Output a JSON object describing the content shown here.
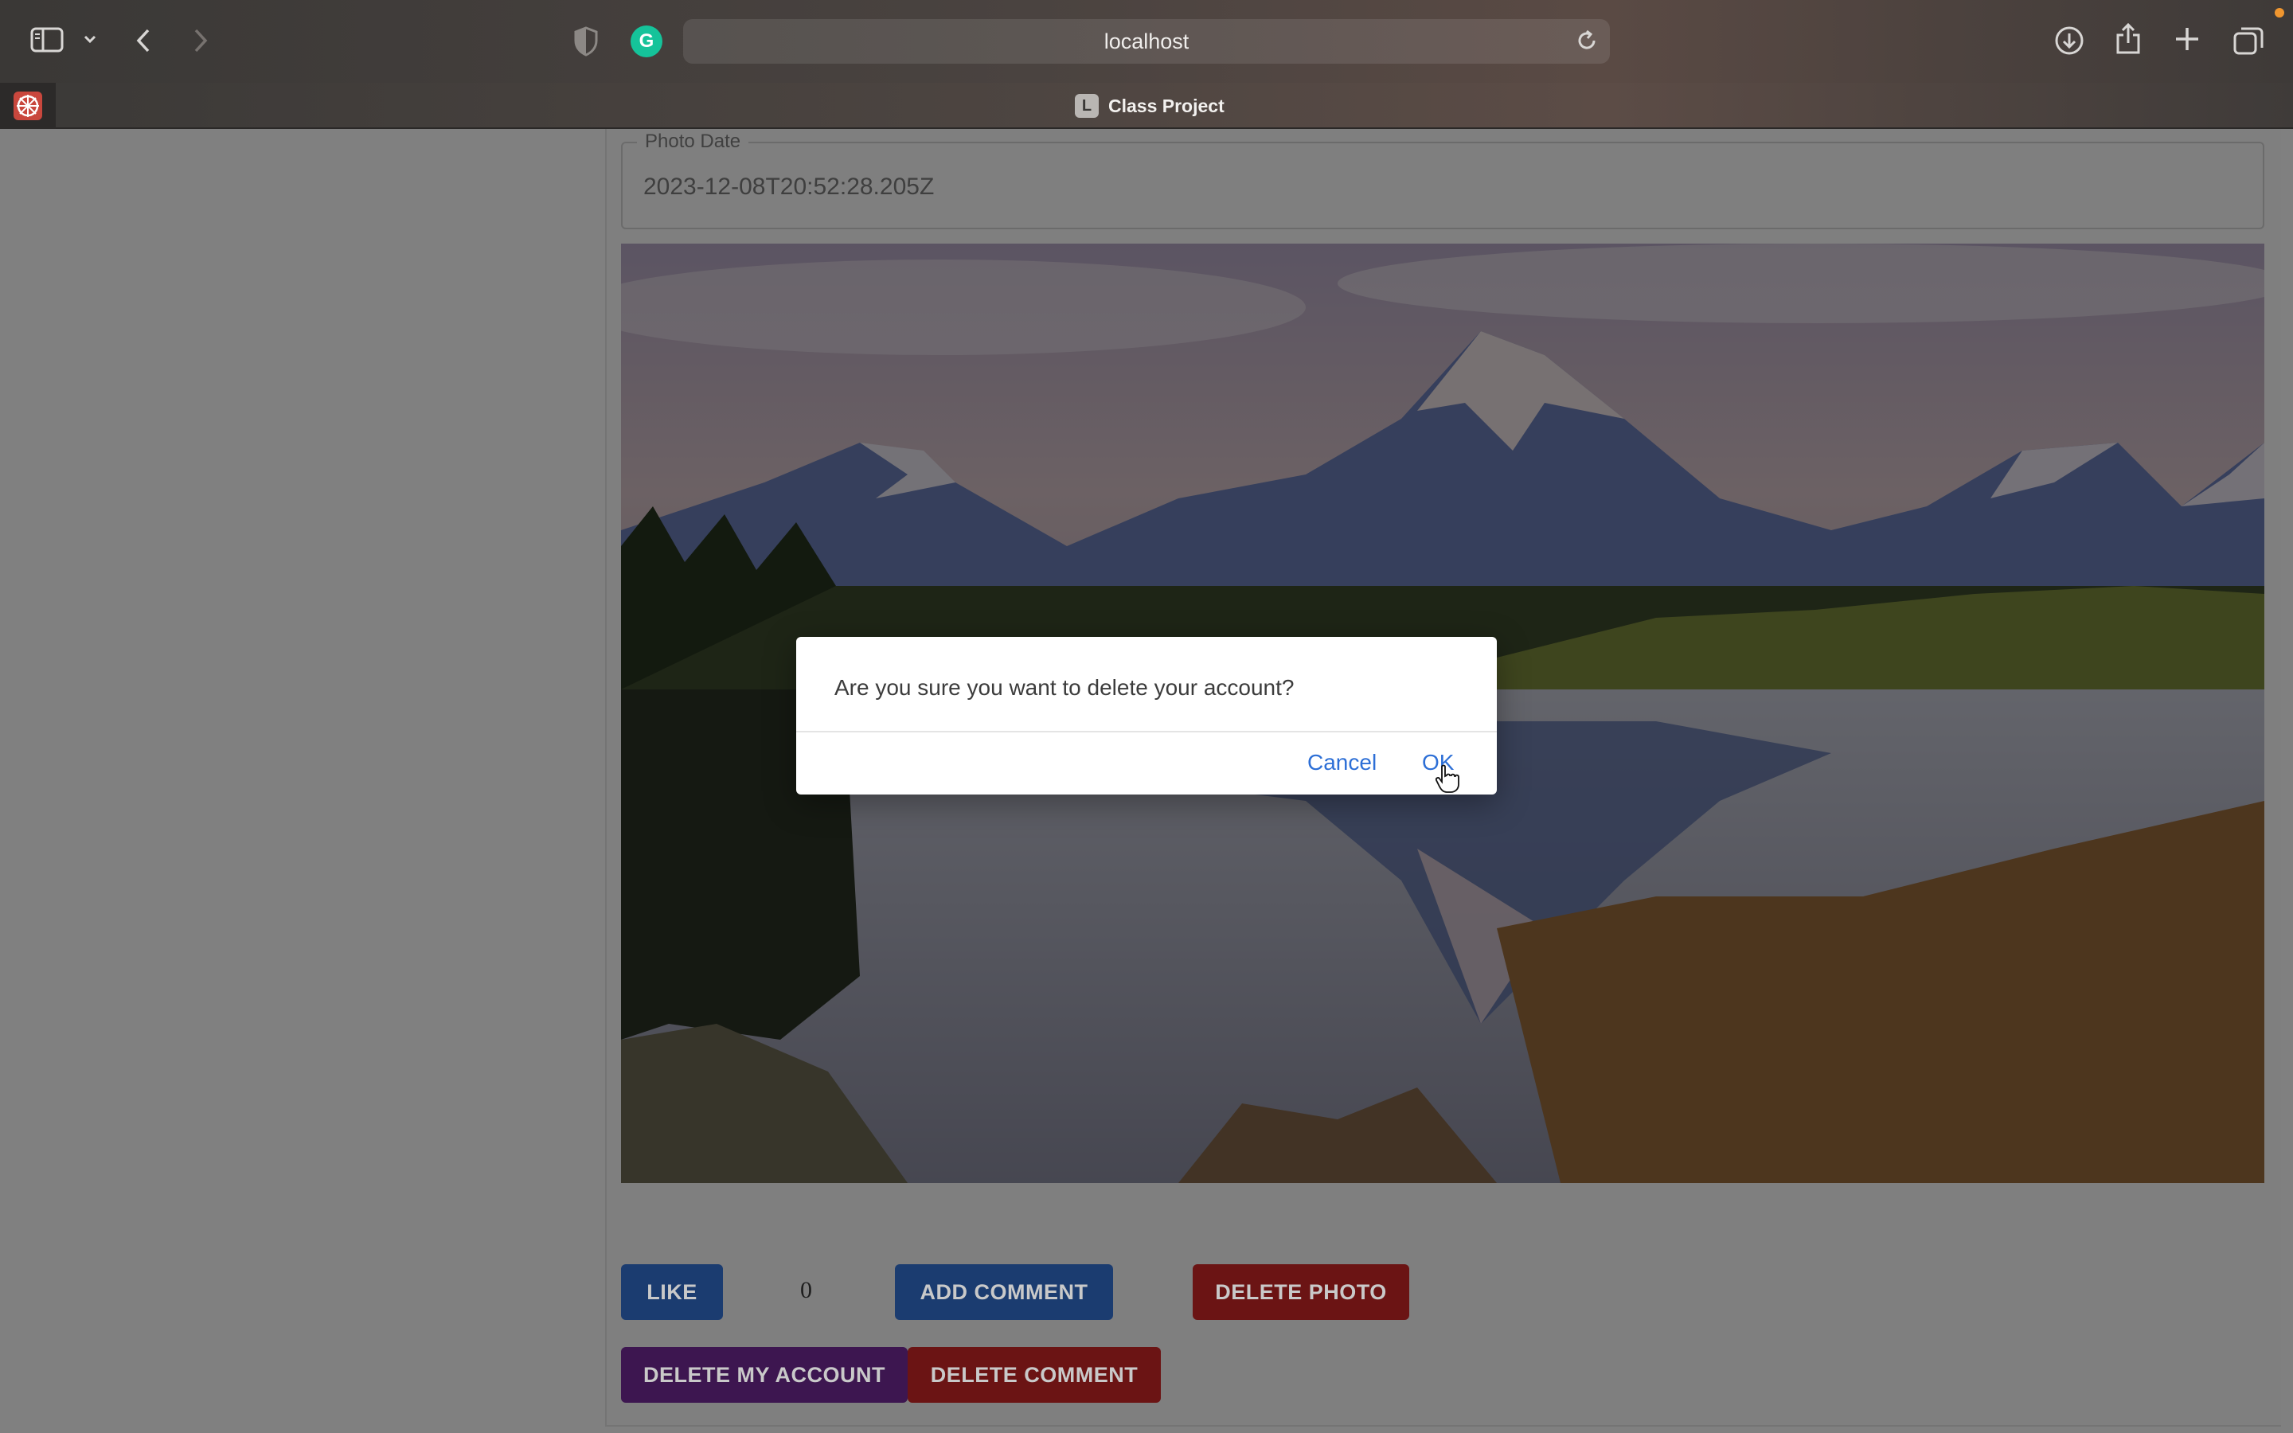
{
  "browser": {
    "url": "localhost",
    "tab_title": "Class Project",
    "tab_favicon_letter": "L"
  },
  "form": {
    "photo_date_label": "Photo Date",
    "photo_date_value": "2023-12-08T20:52:28.205Z"
  },
  "actions": {
    "like_label": "LIKE",
    "like_count": "0",
    "add_comment_label": "ADD COMMENT",
    "delete_photo_label": "DELETE PHOTO",
    "delete_account_label": "DELETE MY ACCOUNT",
    "delete_comment_label": "DELETE COMMENT"
  },
  "dialog": {
    "message": "Are you sure you want to delete your account?",
    "cancel_label": "Cancel",
    "ok_label": "OK"
  },
  "colors": {
    "primary_button": "#1976d2",
    "danger_button": "#d32f2f",
    "account_button": "#7b1fa2",
    "dialog_link": "#2d6fd6"
  }
}
